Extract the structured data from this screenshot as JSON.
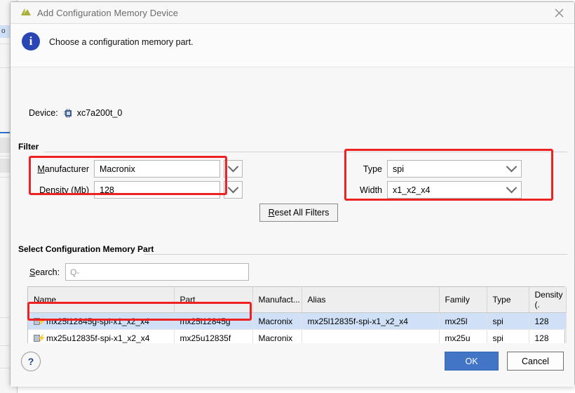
{
  "window": {
    "title": "Add Configuration Memory Device",
    "app_icon": "vivado-logo-icon",
    "close_icon": "close-icon"
  },
  "banner": {
    "icon": "info-icon",
    "icon_glyph": "i",
    "message": "Choose a configuration memory part."
  },
  "device": {
    "label": "Device:",
    "icon": "chip-icon",
    "value": "xc7a200t_0"
  },
  "filter": {
    "group_title": "Filter",
    "manufacturer": {
      "label": "Manufacturer",
      "mnemonic": "M",
      "value": "Macronix",
      "arrow_icon": "chevron-down-icon"
    },
    "density": {
      "label": "Density (Mb)",
      "mnemonic": "Mb",
      "value": "128",
      "arrow_icon": "chevron-down-icon"
    },
    "type": {
      "label": "Type",
      "value": "spi",
      "arrow_icon": "chevron-down-icon"
    },
    "width": {
      "label": "Width",
      "value": "x1_x2_x4",
      "arrow_icon": "chevron-down-icon"
    },
    "reset_label": "Reset All Filters"
  },
  "select_section": {
    "group_title": "Select Configuration Memory Part",
    "search_label": "Search:",
    "search_value": "",
    "search_placeholder": "Q-",
    "search_icon": "search-icon"
  },
  "table": {
    "columns": [
      "Name",
      "Part",
      "Manufact...",
      "Alias",
      "Family",
      "Type",
      "Density (."
    ],
    "rows": [
      {
        "icon": "memory-device-icon",
        "name": "mx25l12845g-spi-x1_x2_x4",
        "part": "mx25l12845g",
        "manufacturer": "Macronix",
        "alias": "mx25l12835f-spi-x1_x2_x4",
        "family": "mx25l",
        "type": "spi",
        "density": "128",
        "selected": true
      },
      {
        "icon": "memory-device-icon",
        "name": "mx25u12835f-spi-x1_x2_x4",
        "part": "mx25u12835f",
        "manufacturer": "Macronix",
        "alias": "",
        "family": "mx25u",
        "type": "spi",
        "density": "128",
        "selected": false
      }
    ],
    "scrollbar": {
      "left_arrow": "‹",
      "right_arrow": "›"
    }
  },
  "footer": {
    "help_label": "?",
    "ok_label": "OK",
    "cancel_label": "Cancel"
  },
  "colors": {
    "accent_blue": "#4275c6",
    "annotation_red": "#ee2222",
    "selection_blue": "#cfe0f7",
    "info_blue": "#2a46b4"
  },
  "background_app": {
    "tab_fragment": "o"
  }
}
